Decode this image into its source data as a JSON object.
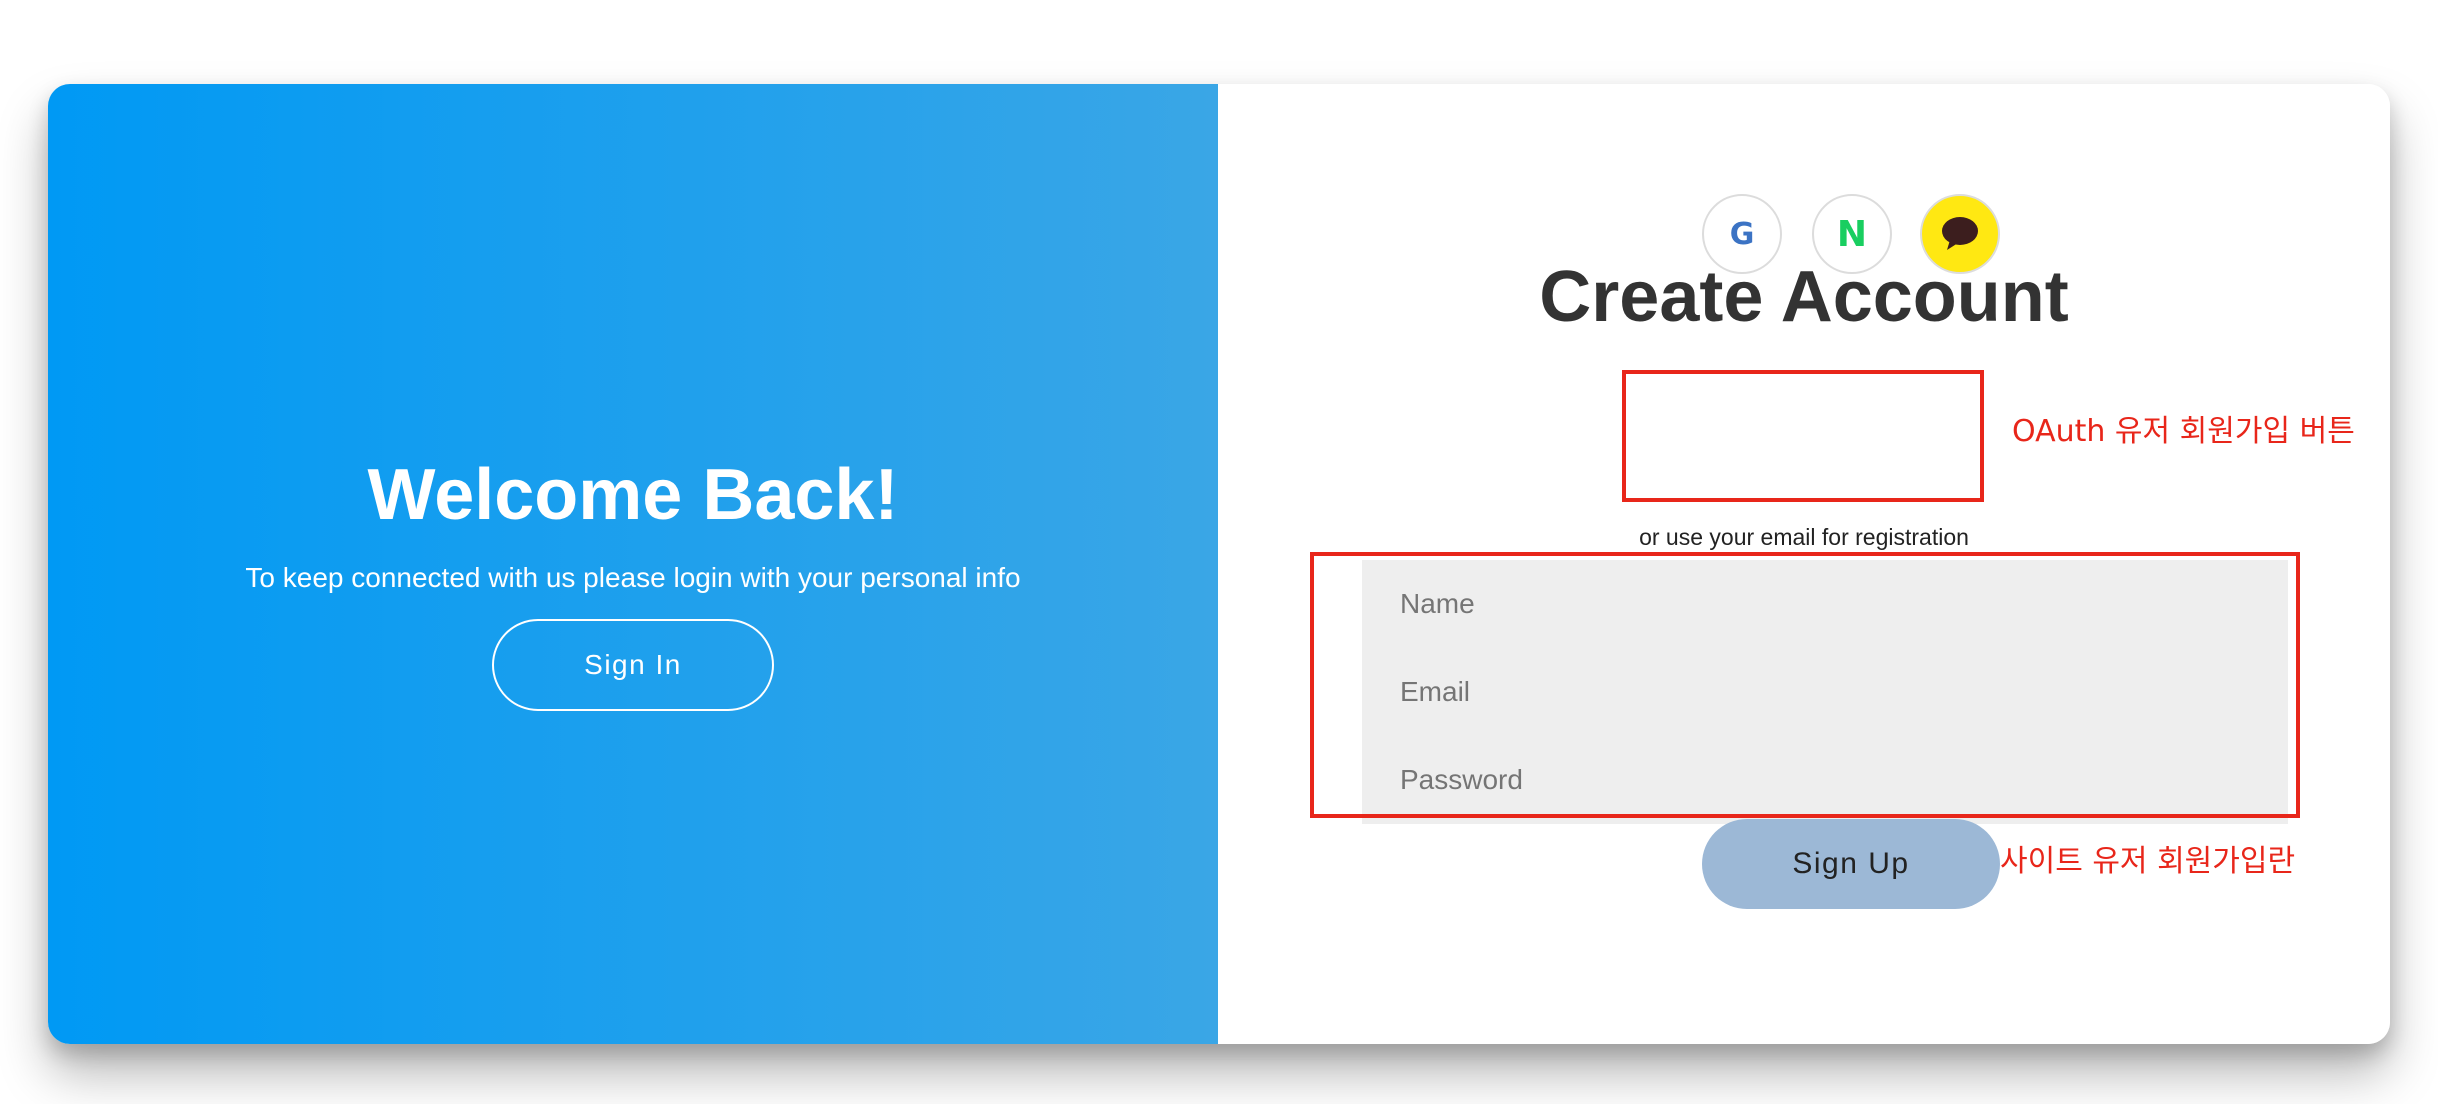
{
  "left_panel": {
    "title": "Welcome Back!",
    "text": "To keep connected with us please login with your personal info",
    "signin_label": "Sign In"
  },
  "right_panel": {
    "title": "Create Account",
    "social": [
      {
        "name": "google",
        "glyph": "G",
        "icon": "google-icon"
      },
      {
        "name": "naver",
        "glyph": "N",
        "icon": "naver-icon"
      },
      {
        "name": "kakao",
        "icon": "kakao-speech-bubble-icon"
      }
    ],
    "register_text": "or use your email for registration",
    "inputs": {
      "name_placeholder": "Name",
      "email_placeholder": "Email",
      "password_placeholder": "Password"
    },
    "signup_label": "Sign Up"
  },
  "annotations": {
    "oauth_label": "OAuth 유저 회원가입 버튼",
    "site_label": "사이트 유저 회원가입란"
  },
  "colors": {
    "gradient_start": "#0099f4",
    "gradient_end": "#3aa6e6",
    "signup_button": "#9cb8d6",
    "annotation_red": "#e8261a",
    "kakao_yellow": "#ffe812",
    "naver_green": "#19ce60"
  }
}
